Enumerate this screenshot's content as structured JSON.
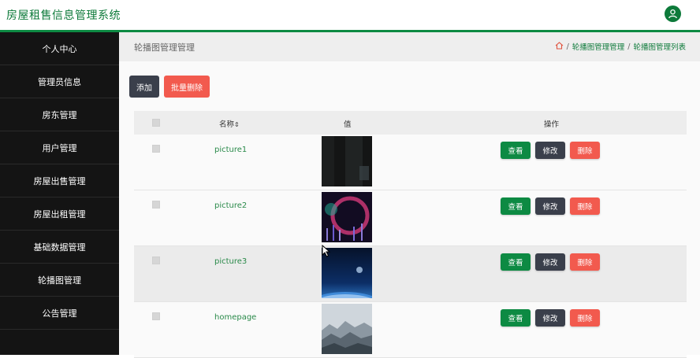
{
  "app": {
    "title": "房屋租售信息管理系统"
  },
  "sidebar": {
    "items": [
      {
        "label": "个人中心"
      },
      {
        "label": "管理员信息"
      },
      {
        "label": "房东管理"
      },
      {
        "label": "用户管理"
      },
      {
        "label": "房屋出售管理"
      },
      {
        "label": "房屋出租管理"
      },
      {
        "label": "基础数据管理"
      },
      {
        "label": "轮播图管理"
      },
      {
        "label": "公告管理"
      }
    ]
  },
  "page": {
    "title": "轮播图管理管理",
    "breadcrumb": [
      "轮播图管理管理",
      "轮播图管理列表"
    ]
  },
  "toolbar": {
    "add_label": "添加",
    "batch_delete_label": "批量删除"
  },
  "table": {
    "headers": {
      "name": "名称",
      "sort_icon": "⇕",
      "value": "值",
      "actions": "操作"
    },
    "rows": [
      {
        "name": "picture1",
        "thumb_style": "dark"
      },
      {
        "name": "picture2",
        "thumb_style": "neon"
      },
      {
        "name": "picture3",
        "thumb_style": "space"
      },
      {
        "name": "homepage",
        "thumb_style": "mist"
      }
    ],
    "actions": {
      "view": "查看",
      "edit": "修改",
      "delete": "删除"
    }
  },
  "colors": {
    "brand_green": "#0d8a43",
    "sidebar_bg": "#141414",
    "danger": "#f25a4e",
    "dark_button": "#3a3f4b"
  }
}
